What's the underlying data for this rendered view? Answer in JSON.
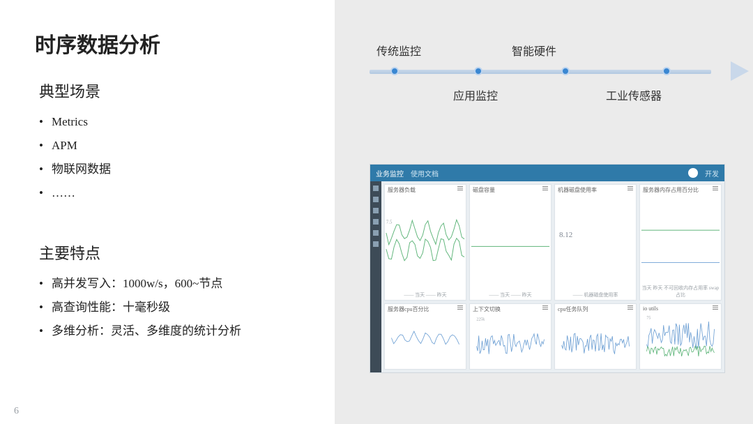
{
  "title": "时序数据分析",
  "page_number": "6",
  "section1": {
    "heading": "典型场景",
    "items": [
      "Metrics",
      "APM",
      "物联网数据",
      "……"
    ]
  },
  "section2": {
    "heading": "主要特点",
    "items": [
      "高并发写入：1000w/s，600~节点",
      "高查询性能：十毫秒级",
      "多维分析：灵活、多维度的统计分析"
    ]
  },
  "timeline": {
    "top": [
      "传统监控",
      "智能硬件"
    ],
    "bottom": [
      "应用监控",
      "工业传感器"
    ]
  },
  "dashboard": {
    "tabs": [
      "业务监控",
      "使用文档"
    ],
    "user_label": "开发",
    "panels": [
      {
        "title": "服务器负载",
        "foot": "—— 当天  —— 昨天",
        "kind": "dual-line",
        "ytick": "7.5"
      },
      {
        "title": "磁盘容量",
        "foot": "—— 当天  —— 昨天",
        "kind": "flat"
      },
      {
        "title": "机器磁盘使用率",
        "foot": "—— 机器磁盘使用率",
        "kind": "stat",
        "stat": "8.12"
      },
      {
        "title": "服务器内存占用百分比",
        "foot": "当天  昨天  不可回收内存占用率  swap占比",
        "kind": "mem"
      },
      {
        "title": "服务器cpu百分比",
        "foot": "",
        "kind": "cpu"
      },
      {
        "title": "上下文切换",
        "foot": "",
        "kind": "noise",
        "ytick": "225k"
      },
      {
        "title": "cpu任务队列",
        "foot": "",
        "kind": "noise"
      },
      {
        "title": "io utils",
        "foot": "",
        "kind": "io",
        "ytick": "75"
      }
    ]
  }
}
